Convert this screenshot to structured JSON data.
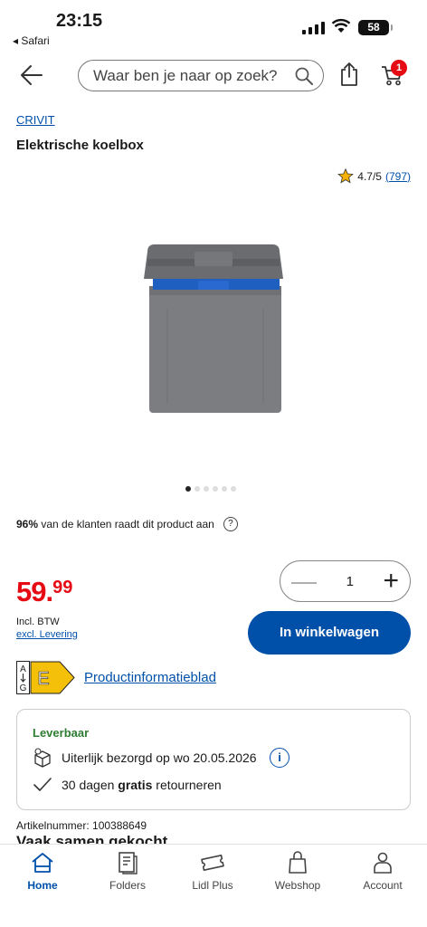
{
  "status_bar": {
    "time": "23:15",
    "back_app": "◂ Safari",
    "battery": "58"
  },
  "header": {
    "search_placeholder": "Waar ben je naar op zoek?",
    "cart_count": "1"
  },
  "product": {
    "brand": "CRIVIT",
    "title": "Elektrische koelbox",
    "rating": "4.7/5",
    "rating_count": "(797)",
    "image_colors": {
      "body": "#7b7d80",
      "lid": "#6a6c70",
      "band": "#1f5fbf"
    }
  },
  "gallery": {
    "total": 6,
    "active": 1
  },
  "recommend": {
    "pct": "96%",
    "text": " van de klanten raadt dit product aan",
    "help": "?"
  },
  "quantity": {
    "minus": "—",
    "value": "1",
    "plus": "+"
  },
  "price": {
    "main": "59.",
    "cents": "99",
    "incl": "Incl. BTW",
    "excl": "excl. Levering",
    "color": "#e60a14"
  },
  "cart_button": "In winkelwagen",
  "energy": {
    "scale_top": "A",
    "scale_bottom": "G",
    "class": "E",
    "label": "Productinformatieblad"
  },
  "delivery": {
    "availability": "Leverbaar",
    "eta": "Uiterlijk bezorgd op wo 20.05.2026",
    "info": "i",
    "returns_prefix": "30 dagen ",
    "returns_bold": "gratis",
    "returns_suffix": " retourneren"
  },
  "article_number": "Artikelnummer: 100388649",
  "partial_heading": "Vaak samen gekocht",
  "tabs": [
    {
      "label": "Home",
      "active": true
    },
    {
      "label": "Folders",
      "active": false
    },
    {
      "label": "Lidl Plus",
      "active": false
    },
    {
      "label": "Webshop",
      "active": false
    },
    {
      "label": "Account",
      "active": false
    }
  ],
  "accent": "#0050aa"
}
